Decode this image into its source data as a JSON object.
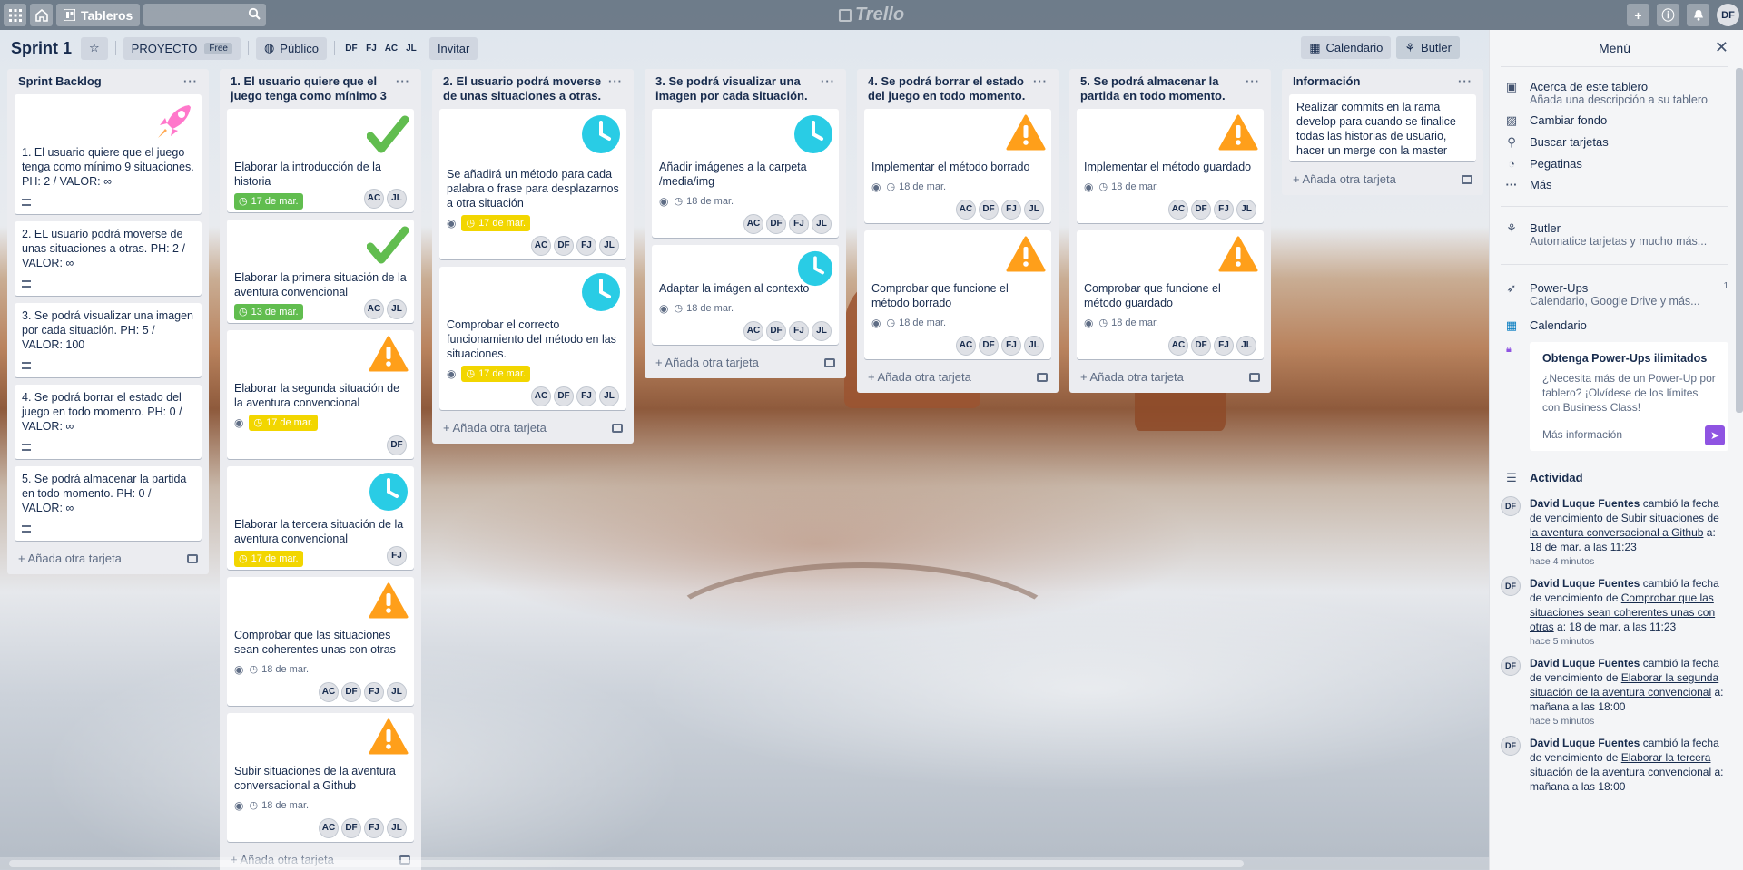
{
  "topbar": {
    "boards_label": "Tableros",
    "logo": "Trello",
    "avatar": "DF",
    "icons": [
      "apps-icon",
      "home-icon",
      "boards-icon",
      "search-icon",
      "plus-icon",
      "info-icon",
      "bell-icon"
    ]
  },
  "header": {
    "title": "Sprint 1",
    "team": "PROYECTO",
    "team_badge": "Free",
    "visibility": "Público",
    "members": [
      "DF",
      "FJ",
      "AC",
      "JL"
    ],
    "invite": "Invitar",
    "calendar": "Calendario",
    "butler": "Butler"
  },
  "lists": [
    {
      "title": "Sprint Backlog",
      "add": "Añada otra tarjeta",
      "cards": [
        {
          "title": "1. El usuario quiere que el juego tenga como mínimo 9 situaciones. PH: 2 / VALOR: ∞",
          "cover": "rocket"
        },
        {
          "title": "2. EL usuario podrá moverse de unas situaciones a otras. PH: 2 / VALOR: ∞"
        },
        {
          "title": "3. Se podrá visualizar una imagen por cada situación. PH: 5 / VALOR: 100"
        },
        {
          "title": "4. Se podrá borrar el estado del juego en todo momento. PH: 0 / VALOR: ∞"
        },
        {
          "title": "5. Se podrá almacenar la partida en todo momento. PH: 0 / VALOR: ∞"
        }
      ]
    },
    {
      "title": "1. El usuario quiere que el juego tenga como mínimo 3",
      "add": "Añada otra tarjeta",
      "cards": [
        {
          "title": "Elaborar la introducción de la historia",
          "cover": "check",
          "due": "17 de mar.",
          "due_style": "green",
          "members": [
            "AC",
            "JL"
          ]
        },
        {
          "title": "Elaborar la primera situación de la aventura convencional",
          "cover": "check",
          "due": "13 de mar.",
          "due_style": "green",
          "members": [
            "AC",
            "JL"
          ]
        },
        {
          "title": "Elaborar la segunda situación de la aventura convencional",
          "cover": "warn",
          "watch": true,
          "due": "17 de mar.",
          "due_style": "yellow",
          "members": [
            "DF"
          ]
        },
        {
          "title": "Elaborar la tercera situación de la aventura convencional",
          "cover": "clock",
          "due": "17 de mar.",
          "due_style": "yellow",
          "members": [
            "FJ"
          ]
        },
        {
          "title": "Comprobar que las situaciones sean coherentes unas con otras",
          "cover": "warn",
          "watch": true,
          "due": "18 de mar.",
          "due_style": "plain",
          "members": [
            "AC",
            "DF",
            "FJ",
            "JL"
          ]
        },
        {
          "title": "Subir situaciones de la aventura conversacional a Github",
          "cover": "warn",
          "watch": true,
          "due": "18 de mar.",
          "due_style": "plain",
          "members": [
            "AC",
            "DF",
            "FJ",
            "JL"
          ]
        }
      ]
    },
    {
      "title": "2. El usuario podrá moverse de unas situaciones a otras.",
      "add": "Añada otra tarjeta",
      "cards": [
        {
          "title": "Se añadirá un método para cada palabra o frase para desplazarnos a otra situación",
          "cover": "clock",
          "watch": true,
          "due": "17 de mar.",
          "due_style": "yellow",
          "members": [
            "AC",
            "DF",
            "FJ",
            "JL"
          ]
        },
        {
          "title": "Comprobar el correcto funcionamiento del método en las situaciones.",
          "cover": "clock",
          "watch": true,
          "due": "17 de mar.",
          "due_style": "yellow",
          "members": [
            "AC",
            "DF",
            "FJ",
            "JL"
          ]
        }
      ]
    },
    {
      "title": "3. Se podrá visualizar una imagen por cada situación.",
      "add": "Añada otra tarjeta",
      "cards": [
        {
          "title": "Añadir imágenes a la carpeta /media/img",
          "cover": "clock",
          "watch": true,
          "due": "18 de mar.",
          "due_style": "plain",
          "members": [
            "AC",
            "DF",
            "FJ",
            "JL"
          ]
        },
        {
          "title": "Adaptar la imágen al contexto",
          "cover": "clock_small",
          "watch": true,
          "due": "18 de mar.",
          "due_style": "plain",
          "members": [
            "AC",
            "DF",
            "FJ",
            "JL"
          ]
        }
      ]
    },
    {
      "title": "4. Se podrá borrar el estado del juego en todo momento.",
      "add": "Añada otra tarjeta",
      "cards": [
        {
          "title": "Implementar el método borrado",
          "cover": "warn",
          "watch": true,
          "due": "18 de mar.",
          "due_style": "plain",
          "members": [
            "AC",
            "DF",
            "FJ",
            "JL"
          ]
        },
        {
          "title": "Comprobar que funcione el método borrado",
          "cover": "warn",
          "watch": true,
          "due": "18 de mar.",
          "due_style": "plain",
          "members": [
            "AC",
            "DF",
            "FJ",
            "JL"
          ]
        }
      ]
    },
    {
      "title": "5. Se podrá almacenar la partida en todo momento.",
      "add": "Añada otra tarjeta",
      "cards": [
        {
          "title": "Implementar el método guardado",
          "cover": "warn",
          "watch": true,
          "due": "18 de mar.",
          "due_style": "plain",
          "members": [
            "AC",
            "DF",
            "FJ",
            "JL"
          ]
        },
        {
          "title": "Comprobar que funcione el método guardado",
          "cover": "warn",
          "watch": true,
          "due": "18 de mar.",
          "due_style": "plain",
          "members": [
            "AC",
            "DF",
            "FJ",
            "JL"
          ]
        }
      ]
    },
    {
      "title": "Información",
      "add": "Añada otra tarjeta",
      "cards": [
        {
          "title": "Realizar commits en la rama develop para cuando se finalice todas las historias de usuario, hacer un merge con la master"
        }
      ]
    }
  ],
  "menu": {
    "title": "Menú",
    "items": [
      {
        "icon": "board-icon",
        "label": "Acerca de este tablero",
        "sub": "Añada una descripción a su tablero"
      },
      {
        "icon": "image-icon",
        "label": "Cambiar fondo"
      },
      {
        "icon": "search-icon",
        "label": "Buscar tarjetas"
      },
      {
        "icon": "sticker-icon",
        "label": "Pegatinas"
      },
      {
        "icon": "more-icon",
        "label": "Más"
      }
    ],
    "butler": {
      "label": "Butler",
      "sub": "Automatice tarjetas y mucho más..."
    },
    "powerups": {
      "label": "Power-Ups",
      "sub": "Calendario, Google Drive y más...",
      "count": "1"
    },
    "calendar": "Calendario",
    "promo": {
      "title": "Obtenga Power-Ups ilimitados",
      "body": "¿Necesita más de un Power-Up por tablero? ¡Olvídese de los límites con Business Class!",
      "link": "Más información"
    },
    "activity_title": "Actividad",
    "activity": [
      {
        "user": "David Luque Fuentes",
        "verb": "cambió la fecha de vencimiento de",
        "card": "Subir situaciones de la aventura conversacional a Github",
        "rest": "a: 18 de mar. a las 11:23",
        "time": "hace 4 minutos"
      },
      {
        "user": "David Luque Fuentes",
        "verb": "cambió la fecha de vencimiento de",
        "card": "Comprobar que las situaciones sean coherentes unas con otras",
        "rest": "a: 18 de mar. a las 11:23",
        "time": "hace 5 minutos"
      },
      {
        "user": "David Luque Fuentes",
        "verb": "cambió la fecha de vencimiento de",
        "card": "Elaborar la segunda situación de la aventura convencional",
        "rest": "a: mañana a las 18:00",
        "time": "hace 5 minutos"
      },
      {
        "user": "David Luque Fuentes",
        "verb": "cambió la fecha de vencimiento de",
        "card": "Elaborar la tercera situación de la aventura convencional",
        "rest": "a: mañana a las 18:00",
        "time": ""
      }
    ]
  }
}
